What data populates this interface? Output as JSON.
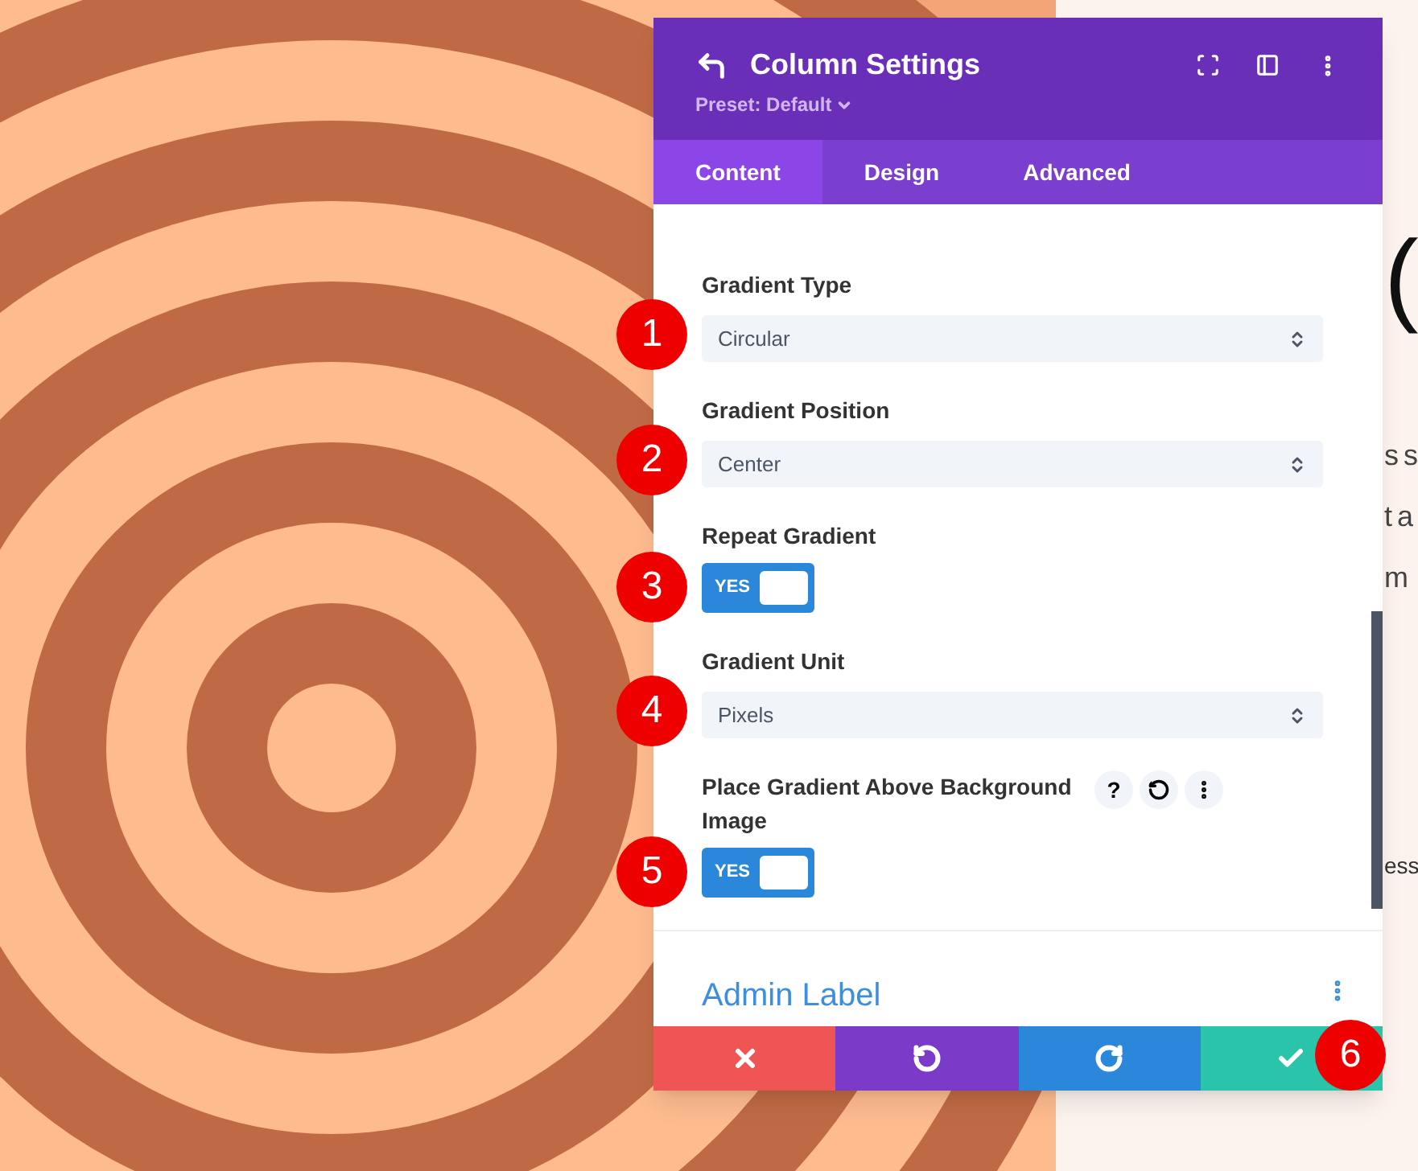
{
  "page": {
    "background_text": [
      {
        "kind": "heading",
        "text": "("
      },
      {
        "kind": "body",
        "text": "s s"
      },
      {
        "kind": "body",
        "text": "t a"
      },
      {
        "kind": "body",
        "text": "m"
      },
      {
        "kind": "small",
        "text": "ess"
      }
    ]
  },
  "panel": {
    "title": "Column Settings",
    "preset": "Preset: Default",
    "tabs": [
      {
        "label": "Content",
        "selected": true
      },
      {
        "label": "Design",
        "selected": false
      },
      {
        "label": "Advanced",
        "selected": false
      }
    ],
    "fields": [
      {
        "kind": "select",
        "label": "Gradient Type",
        "value": "Circular",
        "marker": "1"
      },
      {
        "kind": "select",
        "label": "Gradient Position",
        "value": "Center",
        "marker": "2"
      },
      {
        "kind": "toggle",
        "label": "Repeat Gradient",
        "on": true,
        "toggle_text": "YES",
        "marker": "3"
      },
      {
        "kind": "select",
        "label": "Gradient Unit",
        "value": "Pixels",
        "marker": "4"
      },
      {
        "kind": "toggle",
        "label": "Place Gradient Above Background Image",
        "on": true,
        "toggle_text": "YES",
        "help": "?",
        "marker": "5"
      }
    ],
    "section": "Admin Label",
    "footer_marker": "6"
  }
}
